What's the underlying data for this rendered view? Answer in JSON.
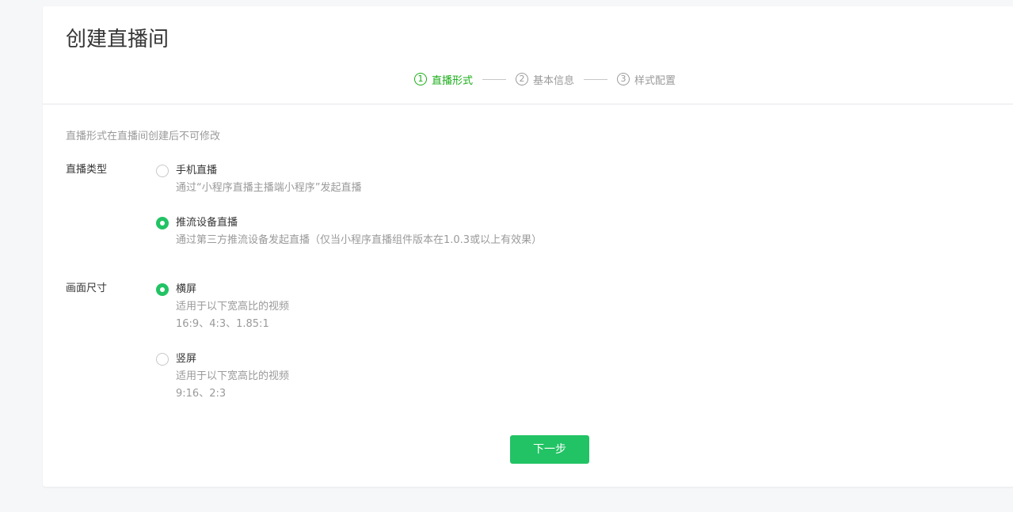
{
  "page": {
    "title": "创建直播间"
  },
  "steps": [
    {
      "num": "1",
      "label": "直播形式",
      "active": true
    },
    {
      "num": "2",
      "label": "基本信息",
      "active": false
    },
    {
      "num": "3",
      "label": "样式配置",
      "active": false
    }
  ],
  "tip": "直播形式在直播间创建后不可修改",
  "live_type": {
    "label": "直播类型",
    "options": [
      {
        "title": "手机直播",
        "desc": "通过“小程序直播主播端小程序”发起直播",
        "checked": false
      },
      {
        "title": "推流设备直播",
        "desc": "通过第三方推流设备发起直播（仅当小程序直播组件版本在1.0.3或以上有效果）",
        "checked": true
      }
    ]
  },
  "screen_size": {
    "label": "画面尺寸",
    "options": [
      {
        "title": "横屏",
        "desc1": "适用于以下宽高比的视频",
        "desc2": "16:9、4:3、1.85:1",
        "checked": true
      },
      {
        "title": "竖屏",
        "desc1": "适用于以下宽高比的视频",
        "desc2": "9:16、2:3",
        "checked": false
      }
    ]
  },
  "next_button": "下一步",
  "colors": {
    "accent": "#22c364",
    "step_active": "#1aad19",
    "muted_text": "#9a9a9a"
  }
}
